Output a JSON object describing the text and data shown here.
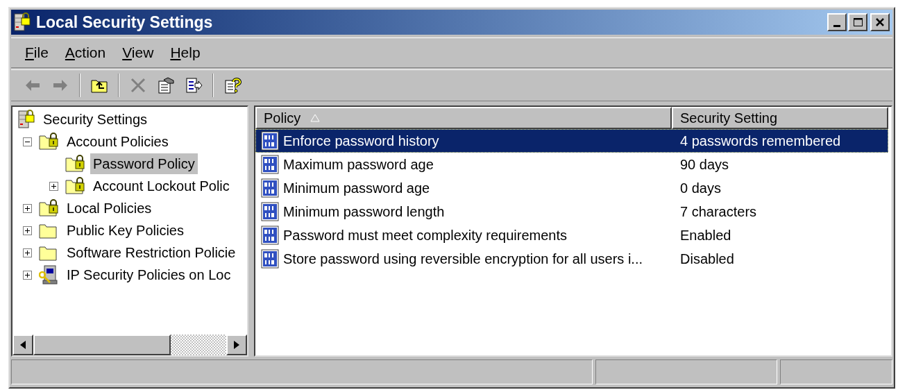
{
  "window": {
    "title": "Local Security Settings"
  },
  "menu": [
    {
      "label": "File"
    },
    {
      "label": "Action"
    },
    {
      "label": "View"
    },
    {
      "label": "Help"
    }
  ],
  "toolbar": [
    {
      "kind": "back",
      "disabled": true
    },
    {
      "kind": "forward",
      "disabled": true
    },
    {
      "kind": "separator"
    },
    {
      "kind": "up",
      "disabled": false
    },
    {
      "kind": "separator"
    },
    {
      "kind": "delete",
      "disabled": true
    },
    {
      "kind": "properties",
      "disabled": false
    },
    {
      "kind": "export",
      "disabled": false
    },
    {
      "kind": "separator"
    },
    {
      "kind": "help",
      "disabled": false
    }
  ],
  "tree": [
    {
      "label": "Security Settings",
      "kind": "server",
      "selected": false,
      "children": [
        {
          "label": "Account Policies",
          "kind": "folder-lock",
          "expanded": true,
          "selected": false,
          "children": [
            {
              "label": "Password Policy",
              "kind": "folder-lock",
              "selected": true
            },
            {
              "label": "Account Lockout Polic",
              "kind": "folder-lock",
              "expanded": false,
              "selected": false
            }
          ]
        },
        {
          "label": "Local Policies",
          "kind": "folder-lock",
          "expanded": false,
          "selected": false
        },
        {
          "label": "Public Key Policies",
          "kind": "folder",
          "expanded": false,
          "selected": false
        },
        {
          "label": "Software Restriction Policie",
          "kind": "folder",
          "expanded": false,
          "selected": false
        },
        {
          "label": "IP Security Policies on Loc",
          "kind": "ip",
          "expanded": false,
          "selected": false
        }
      ]
    }
  ],
  "table": {
    "columns": [
      {
        "label": "Policy",
        "sort_ascending": true
      },
      {
        "label": "Security Setting"
      }
    ],
    "rows": [
      {
        "policy": "Enforce password history",
        "setting": "4 passwords remembered",
        "selected": true
      },
      {
        "policy": "Maximum password age",
        "setting": "90 days",
        "selected": false
      },
      {
        "policy": "Minimum password age",
        "setting": "0 days",
        "selected": false
      },
      {
        "policy": "Minimum password length",
        "setting": "7 characters",
        "selected": false
      },
      {
        "policy": "Password must meet complexity requirements",
        "setting": "Enabled",
        "selected": false
      },
      {
        "policy": "Store password using reversible encryption for all users i...",
        "setting": "Disabled",
        "selected": false
      }
    ]
  }
}
